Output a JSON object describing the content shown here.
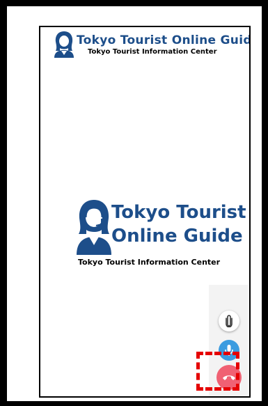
{
  "header": {
    "title": "Tokyo Tourist Online Guide",
    "subtitle": "Tokyo Tourist Information Center"
  },
  "center_logo": {
    "line1": "Tokyo Tourist",
    "line2": "Online Guide",
    "subtitle": "Tokyo Tourist Information Center"
  },
  "controls": {
    "attach_icon": "paperclip-icon",
    "mic_icon": "microphone-icon",
    "hangup_icon": "phone-hangup-icon"
  },
  "colors": {
    "brand": "#1d4e8a",
    "mic": "#3b9ce0",
    "hangup": "#f06173",
    "highlight": "#e50000"
  }
}
